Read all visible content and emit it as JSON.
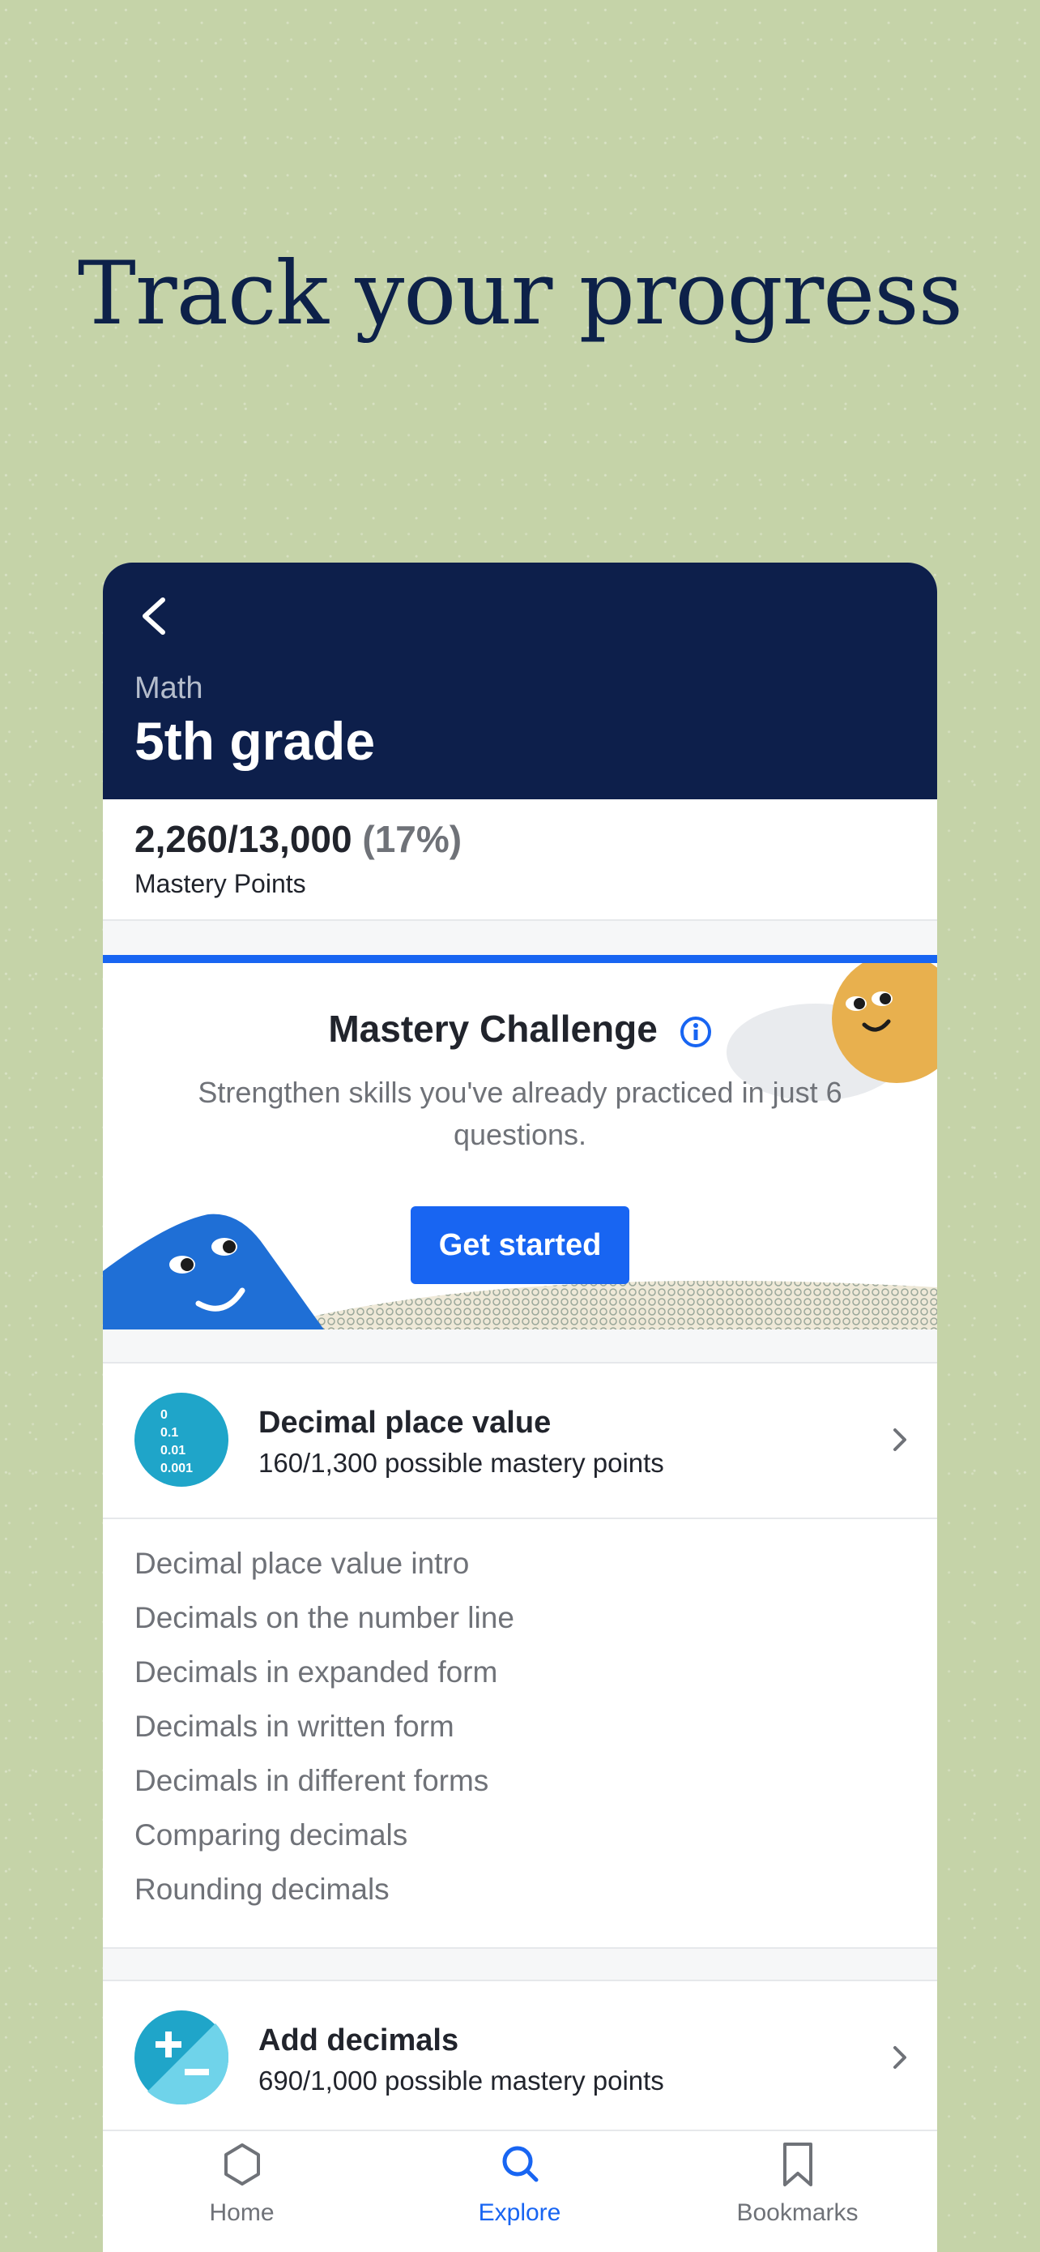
{
  "headline": "Track your progress",
  "header": {
    "subject": "Math",
    "grade": "5th grade"
  },
  "mastery": {
    "points": "2,260/13,000",
    "percent": "(17%)",
    "label": "Mastery Points"
  },
  "challenge": {
    "title": "Mastery Challenge",
    "description": "Strengthen skills you've already practiced in just 6 questions.",
    "button": "Get started"
  },
  "units": [
    {
      "title": "Decimal place value",
      "subtitle": "160/1,300 possible mastery points",
      "icon_lines": [
        "0",
        "0.1",
        "0.01",
        "0.001"
      ]
    },
    {
      "title": "Add decimals",
      "subtitle": "690/1,000 possible mastery points"
    }
  ],
  "lessons": [
    "Decimal place value intro",
    "Decimals on the number line",
    "Decimals in expanded form",
    "Decimals in written form",
    "Decimals in different forms",
    "Comparing decimals",
    "Rounding decimals"
  ],
  "tabs": [
    {
      "label": "Home",
      "icon": "hexagon-icon"
    },
    {
      "label": "Explore",
      "icon": "search-icon"
    },
    {
      "label": "Bookmarks",
      "icon": "bookmark-icon"
    }
  ],
  "colors": {
    "background": "#c5d3a8",
    "navy": "#0d1f4b",
    "accent": "#1865f2",
    "muted_text": "#6f7278",
    "unit_icon": "#1fa5c9"
  }
}
